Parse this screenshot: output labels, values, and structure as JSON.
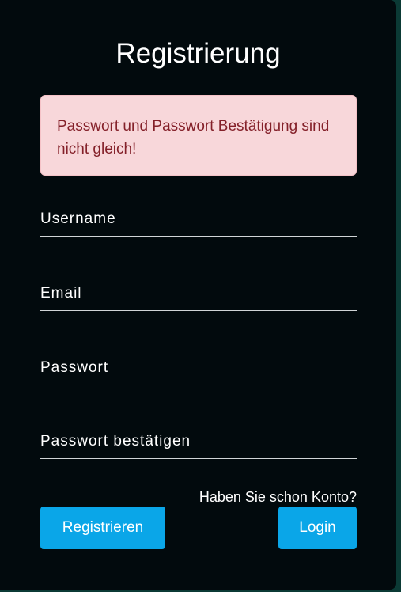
{
  "form": {
    "title": "Registrierung",
    "alert": "Passwort und Passwort Bestätigung sind nicht gleich!",
    "fields": [
      {
        "label": "Username",
        "value": ""
      },
      {
        "label": "Email",
        "value": ""
      },
      {
        "label": "Passwort",
        "value": ""
      },
      {
        "label": "Passwort bestätigen",
        "value": ""
      }
    ],
    "login_hint": "Haben Sie schon Konto?",
    "register_button": "Registrieren",
    "login_button": "Login"
  },
  "colors": {
    "background": "#0b3a35",
    "card": "#020a0d",
    "alert_bg": "#f8d7da",
    "alert_text": "#842029",
    "button": "#0aa6e8"
  }
}
